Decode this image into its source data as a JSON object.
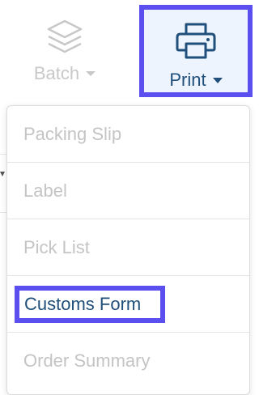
{
  "toolbar": {
    "batch": {
      "label": "Batch",
      "icon": "layers-icon"
    },
    "print": {
      "label": "Print",
      "icon": "printer-icon"
    }
  },
  "print_menu": {
    "items": [
      {
        "label": "Packing Slip"
      },
      {
        "label": "Label"
      },
      {
        "label": "Pick List"
      },
      {
        "label": "Customs Form"
      },
      {
        "label": "Order Summary"
      }
    ]
  },
  "colors": {
    "highlight_border": "#5b4ff0",
    "print_text": "#1f4f7a",
    "print_bg": "#eef4fd",
    "disabled_text": "#c4c4c4"
  }
}
